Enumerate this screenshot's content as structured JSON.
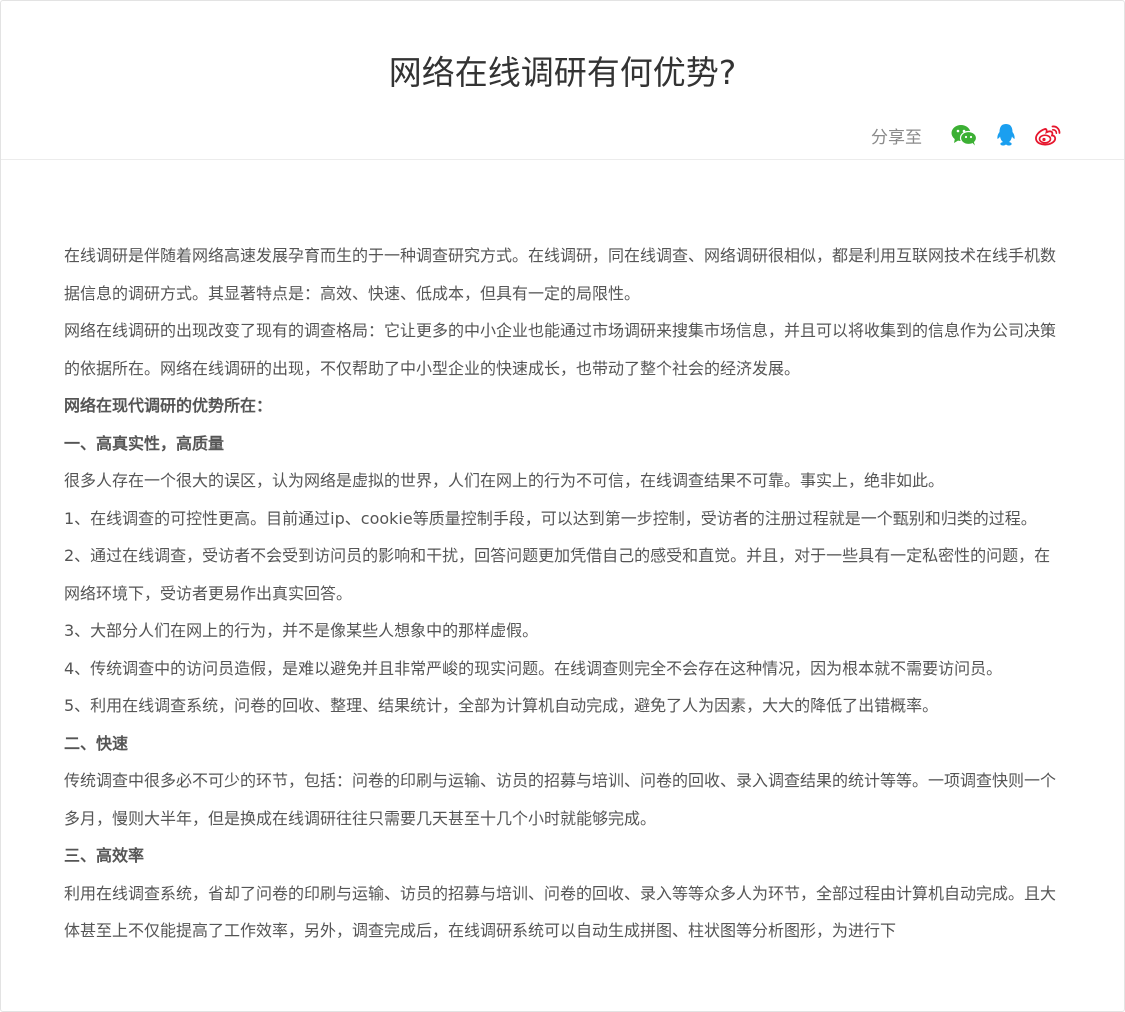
{
  "article": {
    "title": "网络在线调研有何优势?",
    "share_label": "分享至",
    "share_icons": [
      "wechat-icon",
      "qq-icon",
      "weibo-icon"
    ],
    "colors": {
      "wechat": "#3cb034",
      "qq": "#1a9ff0",
      "weibo": "#e6162d"
    },
    "paragraphs": [
      {
        "bold": false,
        "text": "在线调研是伴随着网络高速发展孕育而生的于一种调查研究方式。在线调研，同在线调查、网络调研很相似，都是利用互联网技术在线手机数据信息的调研方式。其显著特点是：高效、快速、低成本，但具有一定的局限性。"
      },
      {
        "bold": false,
        "text": "网络在线调研的出现改变了现有的调查格局：它让更多的中小企业也能通过市场调研来搜集市场信息，并且可以将收集到的信息作为公司决策的依据所在。网络在线调研的出现，不仅帮助了中小型企业的快速成长，也带动了整个社会的经济发展。"
      },
      {
        "bold": true,
        "text": "网络在现代调研的优势所在："
      },
      {
        "bold": true,
        "text": "一、高真实性，高质量"
      },
      {
        "bold": false,
        "text": "很多人存在一个很大的误区，认为网络是虚拟的世界，人们在网上的行为不可信，在线调查结果不可靠。事实上，绝非如此。"
      },
      {
        "bold": false,
        "text": "1、在线调查的可控性更高。目前通过ip、cookie等质量控制手段，可以达到第一步控制，受访者的注册过程就是一个甄别和归类的过程。"
      },
      {
        "bold": false,
        "text": "2、通过在线调查，受访者不会受到访问员的影响和干扰，回答问题更加凭借自己的感受和直觉。并且，对于一些具有一定私密性的问题，在网络环境下，受访者更易作出真实回答。"
      },
      {
        "bold": false,
        "text": "3、大部分人们在网上的行为，并不是像某些人想象中的那样虚假。"
      },
      {
        "bold": false,
        "text": "4、传统调查中的访问员造假，是难以避免并且非常严峻的现实问题。在线调查则完全不会存在这种情况，因为根本就不需要访问员。"
      },
      {
        "bold": false,
        "text": "5、利用在线调查系统，问卷的回收、整理、结果统计，全部为计算机自动完成，避免了人为因素，大大的降低了出错概率。"
      },
      {
        "bold": true,
        "text": "二、快速"
      },
      {
        "bold": false,
        "text": "传统调查中很多必不可少的环节，包括：问卷的印刷与运输、访员的招募与培训、问卷的回收、录入调查结果的统计等等。一项调查快则一个多月，慢则大半年，但是换成在线调研往往只需要几天甚至十几个小时就能够完成。"
      },
      {
        "bold": true,
        "text": "三、高效率"
      },
      {
        "bold": false,
        "text": "利用在线调查系统，省却了问卷的印刷与运输、访员的招募与培训、问卷的回收、录入等等众多人为环节，全部过程由计算机自动完成。且大体甚至上不仅能提高了工作效率，另外，调查完成后，在线调研系统可以自动生成拼图、柱状图等分析图形，为进行下"
      }
    ]
  }
}
